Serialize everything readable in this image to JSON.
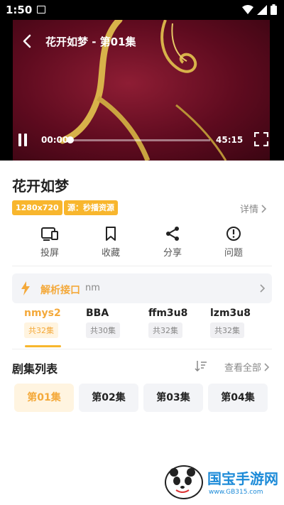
{
  "status_bar": {
    "time": "1:50"
  },
  "player": {
    "title": "花开如梦 - 第01集",
    "current_time": "00:00",
    "total_time": "45:15",
    "progress": 0.0
  },
  "show": {
    "title": "花开如梦",
    "tags": [
      "1280x720",
      "源：秒播资源"
    ],
    "details_label": "详情"
  },
  "actions": [
    {
      "label": "投屏",
      "icon": "cast-icon"
    },
    {
      "label": "收藏",
      "icon": "bookmark-icon"
    },
    {
      "label": "分享",
      "icon": "share-icon"
    },
    {
      "label": "问题",
      "icon": "alert-icon"
    }
  ],
  "parse": {
    "label": "解析接口",
    "value": "nm"
  },
  "sources": [
    {
      "name": "nmys2",
      "count": "共32集",
      "active": true
    },
    {
      "name": "BBA",
      "count": "共30集",
      "active": false
    },
    {
      "name": "ffm3u8",
      "count": "共32集",
      "active": false
    },
    {
      "name": "lzm3u8",
      "count": "共32集",
      "active": false
    }
  ],
  "episodes_header": {
    "title": "剧集列表",
    "view_all": "查看全部"
  },
  "episodes": [
    "第01集",
    "第02集",
    "第03集",
    "第04集"
  ],
  "watermark": {
    "text": "国宝手游网",
    "url": "www.GB315.com"
  },
  "colors": {
    "accent": "#f8b62d",
    "accent_text": "#f4a93a"
  }
}
